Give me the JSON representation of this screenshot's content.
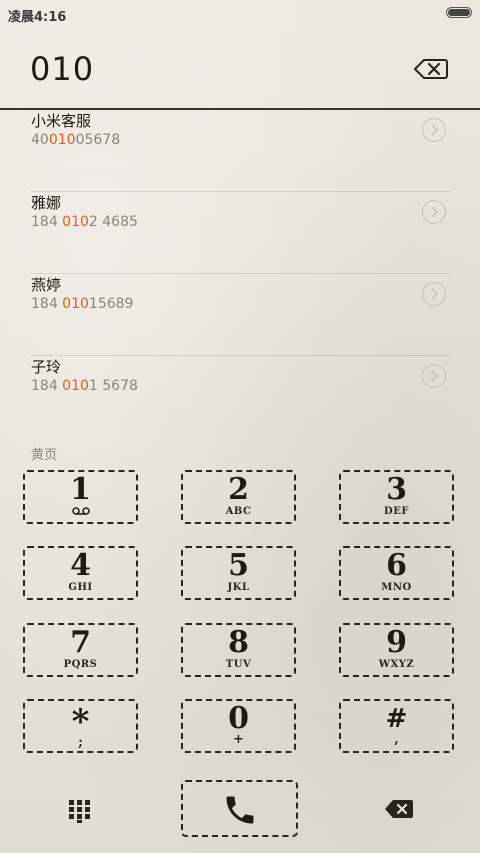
{
  "status_bar": {
    "time": "凌晨4:16"
  },
  "dialer": {
    "input": "010"
  },
  "results": [
    {
      "name": "小米客服",
      "number_pre": "40",
      "number_hl": "010",
      "number_post": "05678"
    },
    {
      "name": "雅娜",
      "number_pre": "184 ",
      "number_hl": "010",
      "number_post": "2 4685"
    },
    {
      "name": "燕婷",
      "number_pre": "184 ",
      "number_hl": "010",
      "number_post": "15689"
    },
    {
      "name": "子玲",
      "number_pre": "184 ",
      "number_hl": "010",
      "number_post": "1 5678"
    }
  ],
  "section_label": "黄页",
  "keys": [
    {
      "digit": "1",
      "letters": ""
    },
    {
      "digit": "2",
      "letters": "ABC"
    },
    {
      "digit": "3",
      "letters": "DEF"
    },
    {
      "digit": "4",
      "letters": "GHI"
    },
    {
      "digit": "5",
      "letters": "JKL"
    },
    {
      "digit": "6",
      "letters": "MNO"
    },
    {
      "digit": "7",
      "letters": "PQRS"
    },
    {
      "digit": "8",
      "letters": "TUV"
    },
    {
      "digit": "9",
      "letters": "WXYZ"
    },
    {
      "digit": "*",
      "letters": ";"
    },
    {
      "digit": "0",
      "letters": "+"
    },
    {
      "digit": "#",
      "letters": ","
    }
  ],
  "colors": {
    "highlight": "#e35a22",
    "ink": "#2a241c",
    "secondary": "#8a847a"
  },
  "icons": {
    "delete_top": "backspace-outline-icon",
    "voicemail": "voicemail-icon",
    "grid": "dialpad-grid-icon",
    "call": "phone-icon",
    "delete_bottom": "backspace-filled-icon",
    "detail": "chevron-right-circle-icon"
  }
}
